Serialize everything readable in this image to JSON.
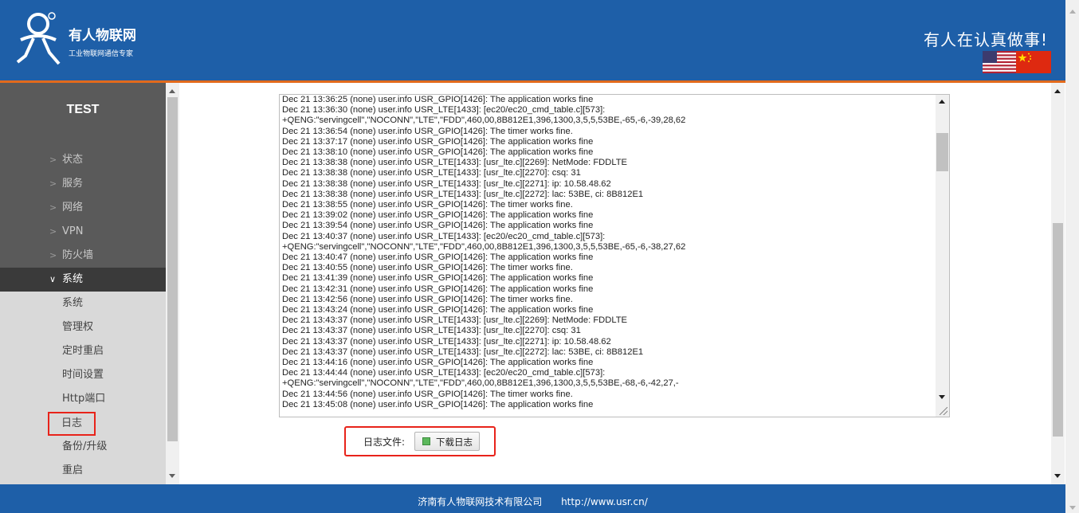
{
  "header": {
    "brand_name": "有人物联网",
    "brand_subtitle": "工业物联网通信专家",
    "slogan": "有人在认真做事!",
    "language_flags": [
      "us-flag-icon",
      "cn-flag-icon"
    ]
  },
  "sidebar": {
    "title": "TEST",
    "menu": [
      {
        "label": "状态",
        "expanded": false
      },
      {
        "label": "服务",
        "expanded": false
      },
      {
        "label": "网络",
        "expanded": false
      },
      {
        "label": "VPN",
        "expanded": false
      },
      {
        "label": "防火墙",
        "expanded": false
      },
      {
        "label": "系统",
        "expanded": true
      }
    ],
    "submenu": [
      "系统",
      "管理权",
      "定时重启",
      "时间设置",
      "Http端口",
      "日志",
      "备份/升级",
      "重启"
    ],
    "selected_submenu": "日志"
  },
  "log": {
    "text": "Dec 21 13:36:25 (none) user.info USR_GPIO[1426]: The application works fine\nDec 21 13:36:30 (none) user.info USR_LTE[1433]: [ec20/ec20_cmd_table.c][573]:\n+QENG:\"servingcell\",\"NOCONN\",\"LTE\",\"FDD\",460,00,8B812E1,396,1300,3,5,5,53BE,-65,-6,-39,28,62\nDec 21 13:36:54 (none) user.info USR_GPIO[1426]: The timer works fine.\nDec 21 13:37:17 (none) user.info USR_GPIO[1426]: The application works fine\nDec 21 13:38:10 (none) user.info USR_GPIO[1426]: The application works fine\nDec 21 13:38:38 (none) user.info USR_LTE[1433]: [usr_lte.c][2269]: NetMode: FDDLTE\nDec 21 13:38:38 (none) user.info USR_LTE[1433]: [usr_lte.c][2270]: csq: 31\nDec 21 13:38:38 (none) user.info USR_LTE[1433]: [usr_lte.c][2271]: ip: 10.58.48.62\nDec 21 13:38:38 (none) user.info USR_LTE[1433]: [usr_lte.c][2272]: lac: 53BE, ci: 8B812E1\nDec 21 13:38:55 (none) user.info USR_GPIO[1426]: The timer works fine.\nDec 21 13:39:02 (none) user.info USR_GPIO[1426]: The application works fine\nDec 21 13:39:54 (none) user.info USR_GPIO[1426]: The application works fine\nDec 21 13:40:37 (none) user.info USR_LTE[1433]: [ec20/ec20_cmd_table.c][573]:\n+QENG:\"servingcell\",\"NOCONN\",\"LTE\",\"FDD\",460,00,8B812E1,396,1300,3,5,5,53BE,-65,-6,-38,27,62\nDec 21 13:40:47 (none) user.info USR_GPIO[1426]: The application works fine\nDec 21 13:40:55 (none) user.info USR_GPIO[1426]: The timer works fine.\nDec 21 13:41:39 (none) user.info USR_GPIO[1426]: The application works fine\nDec 21 13:42:31 (none) user.info USR_GPIO[1426]: The application works fine\nDec 21 13:42:56 (none) user.info USR_GPIO[1426]: The timer works fine.\nDec 21 13:43:24 (none) user.info USR_GPIO[1426]: The application works fine\nDec 21 13:43:37 (none) user.info USR_LTE[1433]: [usr_lte.c][2269]: NetMode: FDDLTE\nDec 21 13:43:37 (none) user.info USR_LTE[1433]: [usr_lte.c][2270]: csq: 31\nDec 21 13:43:37 (none) user.info USR_LTE[1433]: [usr_lte.c][2271]: ip: 10.58.48.62\nDec 21 13:43:37 (none) user.info USR_LTE[1433]: [usr_lte.c][2272]: lac: 53BE, ci: 8B812E1\nDec 21 13:44:16 (none) user.info USR_GPIO[1426]: The application works fine\nDec 21 13:44:44 (none) user.info USR_LTE[1433]: [ec20/ec20_cmd_table.c][573]:\n+QENG:\"servingcell\",\"NOCONN\",\"LTE\",\"FDD\",460,00,8B812E1,396,1300,3,5,5,53BE,-68,-6,-42,27,-\nDec 21 13:44:56 (none) user.info USR_GPIO[1426]: The timer works fine.\nDec 21 13:45:08 (none) user.info USR_GPIO[1426]: The application works fine"
  },
  "download": {
    "label": "日志文件:",
    "button_label": "下载日志"
  },
  "footer": {
    "company": "济南有人物联网技术有限公司",
    "url": "http://www.usr.cn/"
  },
  "colors": {
    "header_bg": "#1e5fa8",
    "header_accent": "#e26a1c",
    "sidebar_dark": "#5a5a5a",
    "sidebar_active": "#3a3a3a",
    "highlight_red": "#e8231a"
  }
}
